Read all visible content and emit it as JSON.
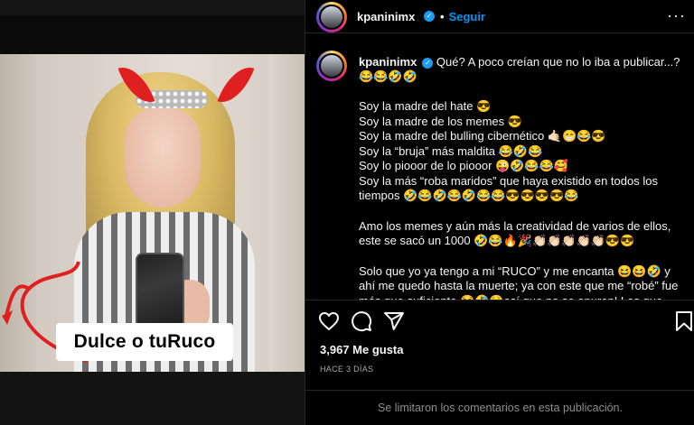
{
  "media": {
    "overlay_text": "Dulce o tuRuco"
  },
  "post": {
    "username": "kpaninimx",
    "verified_icon": "verified-badge-icon",
    "follow_label": "Seguir",
    "more_label": "···",
    "caption_first_line": "Qué? A poco creían que no lo iba a publicar...? 😂😂🤣🤣",
    "caption_lines_block1": [
      "Soy la madre del hate 😎",
      "Soy la madre de los memes 😎",
      "Soy la madre del bulling cibernético 🤙🏻😁😂😎",
      "Soy la “bruja” más maldita 😂🤣😂",
      "Soy lo piooor de lo piooor 😜🤣😂😂🥰",
      "Soy la más “roba maridos” que haya existido en todos los tiempos 🤣😂🤣😂🤣😂😂😎😎😎😎😂"
    ],
    "caption_block2": "Amo los memes y aún más la creatividad de varios de ellos, este se sacó un 1000 🤣😂🔥🎉👏🏻👏🏻👏🏻👏🏻👏🏻😎😎",
    "caption_block3": "Solo que yo ya tengo a mi “RUCO” y me encanta 😆😆🤣 y ahí me quedo hasta la muerte; ya con este que me “robé” fue más que suficiente 😂🤣☺️así que no se apuren! Las que andan",
    "likes": "3,967 Me gusta",
    "timestamp": "HACE 3 DÍAS",
    "comments_disabled": "Se limitaron los comentarios en esta publicación."
  },
  "icons": {
    "like": "heart-icon",
    "comment": "comment-icon",
    "share": "paper-plane-icon",
    "save": "bookmark-icon"
  },
  "colors": {
    "link_blue": "#0095f6",
    "background": "#000000",
    "border": "#262626",
    "muted_text": "#8e8e8e"
  }
}
